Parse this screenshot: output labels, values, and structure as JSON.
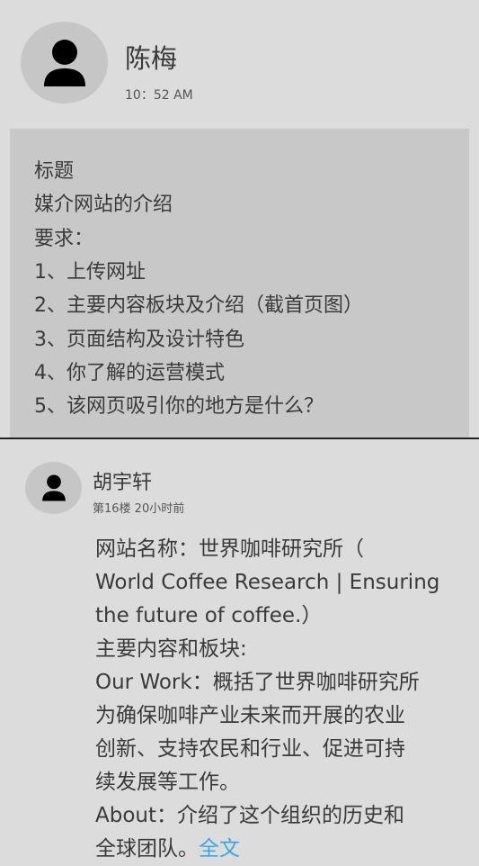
{
  "post": {
    "author": "陈梅",
    "time": "10：52 AM",
    "lines": [
      "标题",
      "媒介网站的介绍",
      "要求：",
      "1、上传网址",
      "2、主要内容板块及介绍（截首页图）",
      "3、页面结构及设计特色",
      "4、你了解的运营模式",
      "5、该网页吸引你的地方是什么？"
    ]
  },
  "reply": {
    "author": "胡宇轩",
    "meta": "第16楼 20小时前",
    "lines": [
      "网站名称：世界咖啡研究所（",
      "World Coffee Research | Ensuring",
      "the future of coffee.）",
      "主要内容和板块:",
      "Our Work：概括了世界咖啡研究所",
      "为确保咖啡产业未来而开展的农业",
      "创新、支持农民和行业、促进可持",
      "续发展等工作。",
      "About：介绍了这个组织的历史和",
      "全球团队。"
    ],
    "full_text_link": "全文"
  },
  "colors": {
    "background": "#dcdcdc",
    "content_box": "#c8c8c8",
    "link": "#3aa7e0",
    "divider": "#222222"
  },
  "icons": {
    "avatar": "user-icon"
  }
}
